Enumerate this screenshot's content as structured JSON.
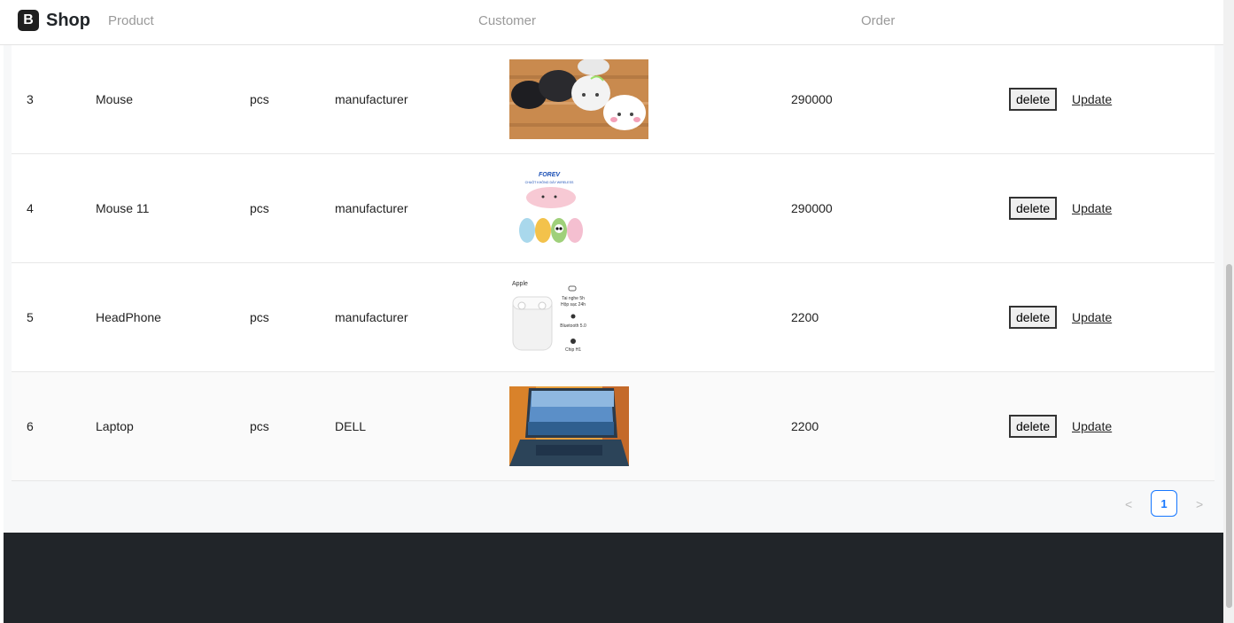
{
  "nav": {
    "brand_logo": "B",
    "brand_name": "Shop",
    "links": [
      "Product",
      "Customer",
      "Order"
    ]
  },
  "products": [
    {
      "id": "3",
      "name": "Mouse",
      "unit": "pcs",
      "maker": "manufacturer",
      "image": "mouse-photo",
      "price": "290000",
      "delete_label": "delete",
      "update_label": "Update"
    },
    {
      "id": "4",
      "name": "Mouse 11",
      "unit": "pcs",
      "maker": "manufacturer",
      "image": "wireless-mouse-ad",
      "price": "290000",
      "delete_label": "delete",
      "update_label": "Update",
      "ad_brand": "FOREV",
      "ad_caption": "CHUỘT KHÔNG DÂY WIRELESS"
    },
    {
      "id": "5",
      "name": "HeadPhone",
      "unit": "pcs",
      "maker": "manufacturer",
      "image": "airpods-ad",
      "price": "2200",
      "delete_label": "delete",
      "update_label": "Update",
      "ad_brand": "Apple",
      "ad_lines": [
        "Tai nghe 5h",
        "Hộp sạc 24h",
        "Bluetooth 5.0",
        "Chip H1"
      ]
    },
    {
      "id": "6",
      "name": "Laptop",
      "unit": "pcs",
      "maker": "DELL",
      "image": "laptop-photo",
      "price": "2200",
      "delete_label": "delete",
      "update_label": "Update"
    }
  ],
  "pagination": {
    "prev": "<",
    "page": "1",
    "next": ">"
  }
}
